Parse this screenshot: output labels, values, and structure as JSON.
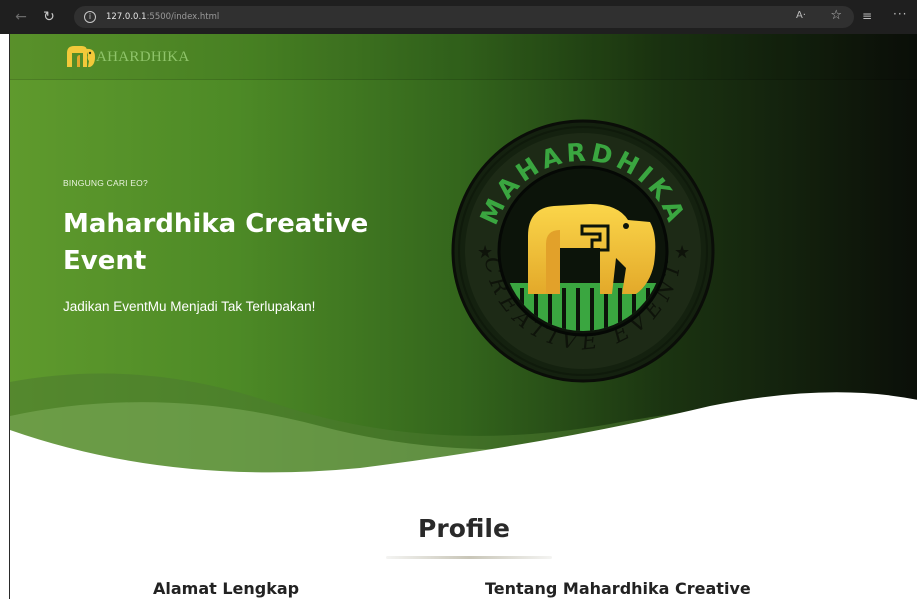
{
  "browser": {
    "url_host": "127.0.0.1",
    "url_rest": ":5500/index.html",
    "read_aloud_label": "A·",
    "icons": [
      "back-icon",
      "reload-icon",
      "info-icon",
      "favorite-star-icon",
      "collections-icon",
      "more-icon"
    ]
  },
  "navbar": {
    "brand": "AHARDHIKA"
  },
  "hero": {
    "eyebrow": "BINGUNG CARI EO?",
    "title": "Mahardhika Creative Event",
    "subtitle": "Jadikan EventMu Menjadi Tak Terlupakan!",
    "logo": {
      "top_text": "MAHARDHIKA",
      "bottom_text": "CREATIVE EVENT"
    }
  },
  "profile": {
    "title": "Profile",
    "left_heading": "Alamat Lengkap",
    "right_heading": "Tentang Mahardhika Creative"
  },
  "colors": {
    "hero_green": "#5f9a2d",
    "hero_dark": "#0b0f09",
    "logo_gold": "#f3c93a",
    "logo_green": "#3aa640",
    "brand_text": "#8fc46a"
  }
}
